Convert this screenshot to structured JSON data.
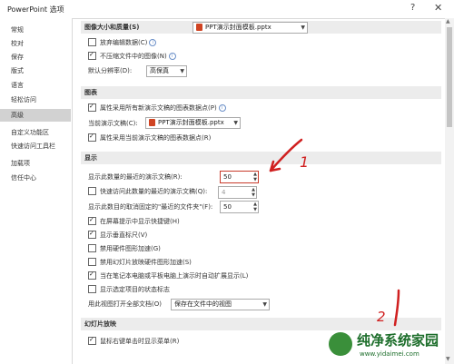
{
  "window": {
    "title": "PowerPoint 选项",
    "help": "?",
    "close": "✕"
  },
  "sidebar": {
    "items": [
      {
        "label": "常规"
      },
      {
        "label": "校对"
      },
      {
        "label": "保存"
      },
      {
        "label": "版式"
      },
      {
        "label": "语言"
      },
      {
        "label": "轻松访问"
      },
      {
        "label": "高级",
        "active": true
      },
      {
        "label": "自定义功能区"
      },
      {
        "label": "快速访问工具栏"
      },
      {
        "label": "加载项"
      },
      {
        "label": "信任中心"
      }
    ]
  },
  "image_section": {
    "header": "图像大小和质量(S)",
    "file_select": "PPT演示封面模板.pptx",
    "discard_edit": "放弃编辑数据(C)",
    "no_compress": "不压缩文件中的图像(N)",
    "resolution_label": "默认分辨率(D):",
    "resolution_value": "高保真"
  },
  "chart_section": {
    "header": "图表",
    "all_new": "属性采用所有新演示文稿的图表数据点(P)",
    "current_label": "当前演示文稿(C):",
    "current_value": "PPT演示封面模板.pptx",
    "current_prop": "属性采用当前演示文稿的图表数据点(R)"
  },
  "display_section": {
    "header": "显示",
    "recent_count_label": "显示此数量的最近的演示文稿(R):",
    "recent_count_value": "50",
    "quick_access_label": "快速访问此数量的最近的演示文稿(Q):",
    "quick_access_value": "4",
    "unpinned_label": "显示此数目的取消固定的\"最近的文件夹\"(F):",
    "unpinned_value": "50",
    "shortcut_keys": "在屏幕提示中显示快捷键(H)",
    "vertical_ruler": "显示垂直标尺(V)",
    "disable_hw_accel": "禁用硬件图形加速(G)",
    "disable_slideshow_accel": "禁用幻灯片放映硬件图形加速(S)",
    "auto_extend": "当在笔记本电脑或平板电脑上演示时自动扩展显示(L)",
    "status_indicator": "显示选定项目的状态标志",
    "open_view_label": "用此视图打开全部文档(O)",
    "open_view_value": "保存在文件中的视图"
  },
  "slideshow_section": {
    "header": "幻灯片放映",
    "right_click_menu": "鼠标右键单击时显示菜单(R)"
  },
  "annotations": {
    "one": "1",
    "two": "2"
  },
  "watermark": {
    "brand": "纯净系统家园",
    "url": "www.yidaimei.com"
  }
}
